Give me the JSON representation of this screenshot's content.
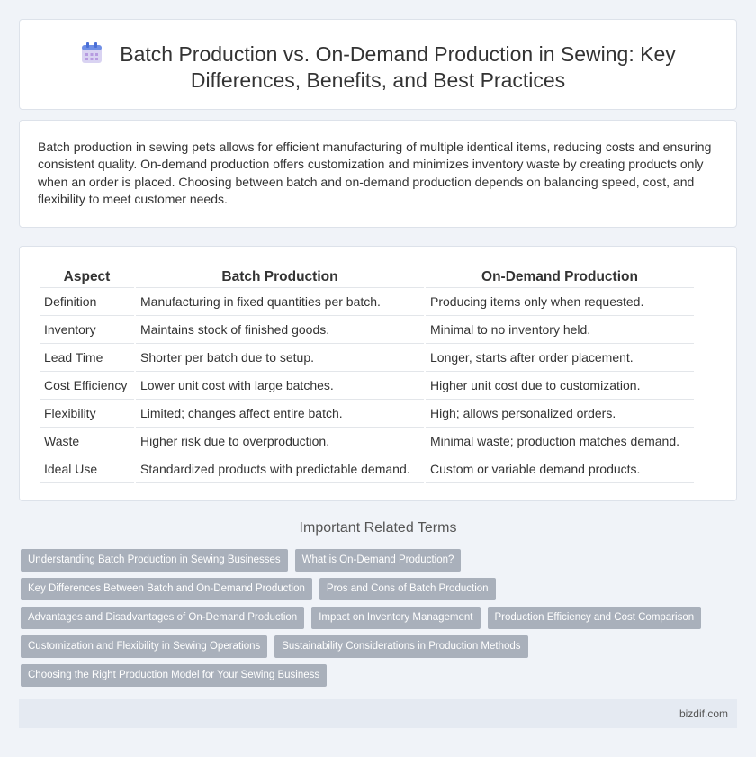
{
  "header": {
    "title_line1": "Batch Production vs. On-Demand Production in Sewing: Key",
    "title_line2": "Differences, Benefits, and Best Practices",
    "icon": "calendar-icon"
  },
  "intro": {
    "text": "Batch production in sewing pets allows for efficient manufacturing of multiple identical items, reducing costs and ensuring consistent quality. On-demand production offers customization and minimizes inventory waste by creating products only when an order is placed. Choosing between batch and on-demand production depends on balancing speed, cost, and flexibility to meet customer needs."
  },
  "table": {
    "headers": [
      "Aspect",
      "Batch Production",
      "On-Demand Production"
    ],
    "rows": [
      [
        "Definition",
        "Manufacturing in fixed quantities per batch.",
        "Producing items only when requested."
      ],
      [
        "Inventory",
        "Maintains stock of finished goods.",
        "Minimal to no inventory held."
      ],
      [
        "Lead Time",
        "Shorter per batch due to setup.",
        "Longer, starts after order placement."
      ],
      [
        "Cost Efficiency",
        "Lower unit cost with large batches.",
        "Higher unit cost due to customization."
      ],
      [
        "Flexibility",
        "Limited; changes affect entire batch.",
        "High; allows personalized orders."
      ],
      [
        "Waste",
        "Higher risk due to overproduction.",
        "Minimal waste; production matches demand."
      ],
      [
        "Ideal Use",
        "Standardized products with predictable demand.",
        "Custom or variable demand products."
      ]
    ]
  },
  "related": {
    "title": "Important Related Terms",
    "rows": [
      [
        "Understanding Batch Production in Sewing Businesses",
        "What is On-Demand Production?"
      ],
      [
        "Key Differences Between Batch and On-Demand Production",
        "Pros and Cons of Batch Production"
      ],
      [
        "Advantages and Disadvantages of On-Demand Production",
        "Impact on Inventory Management",
        "Production Efficiency and Cost Comparison"
      ],
      [
        "Customization and Flexibility in Sewing Operations",
        "Sustainability Considerations in Production Methods"
      ],
      [
        "Choosing the Right Production Model for Your Sewing Business"
      ]
    ]
  },
  "footer": {
    "site": "bizdif.com"
  }
}
